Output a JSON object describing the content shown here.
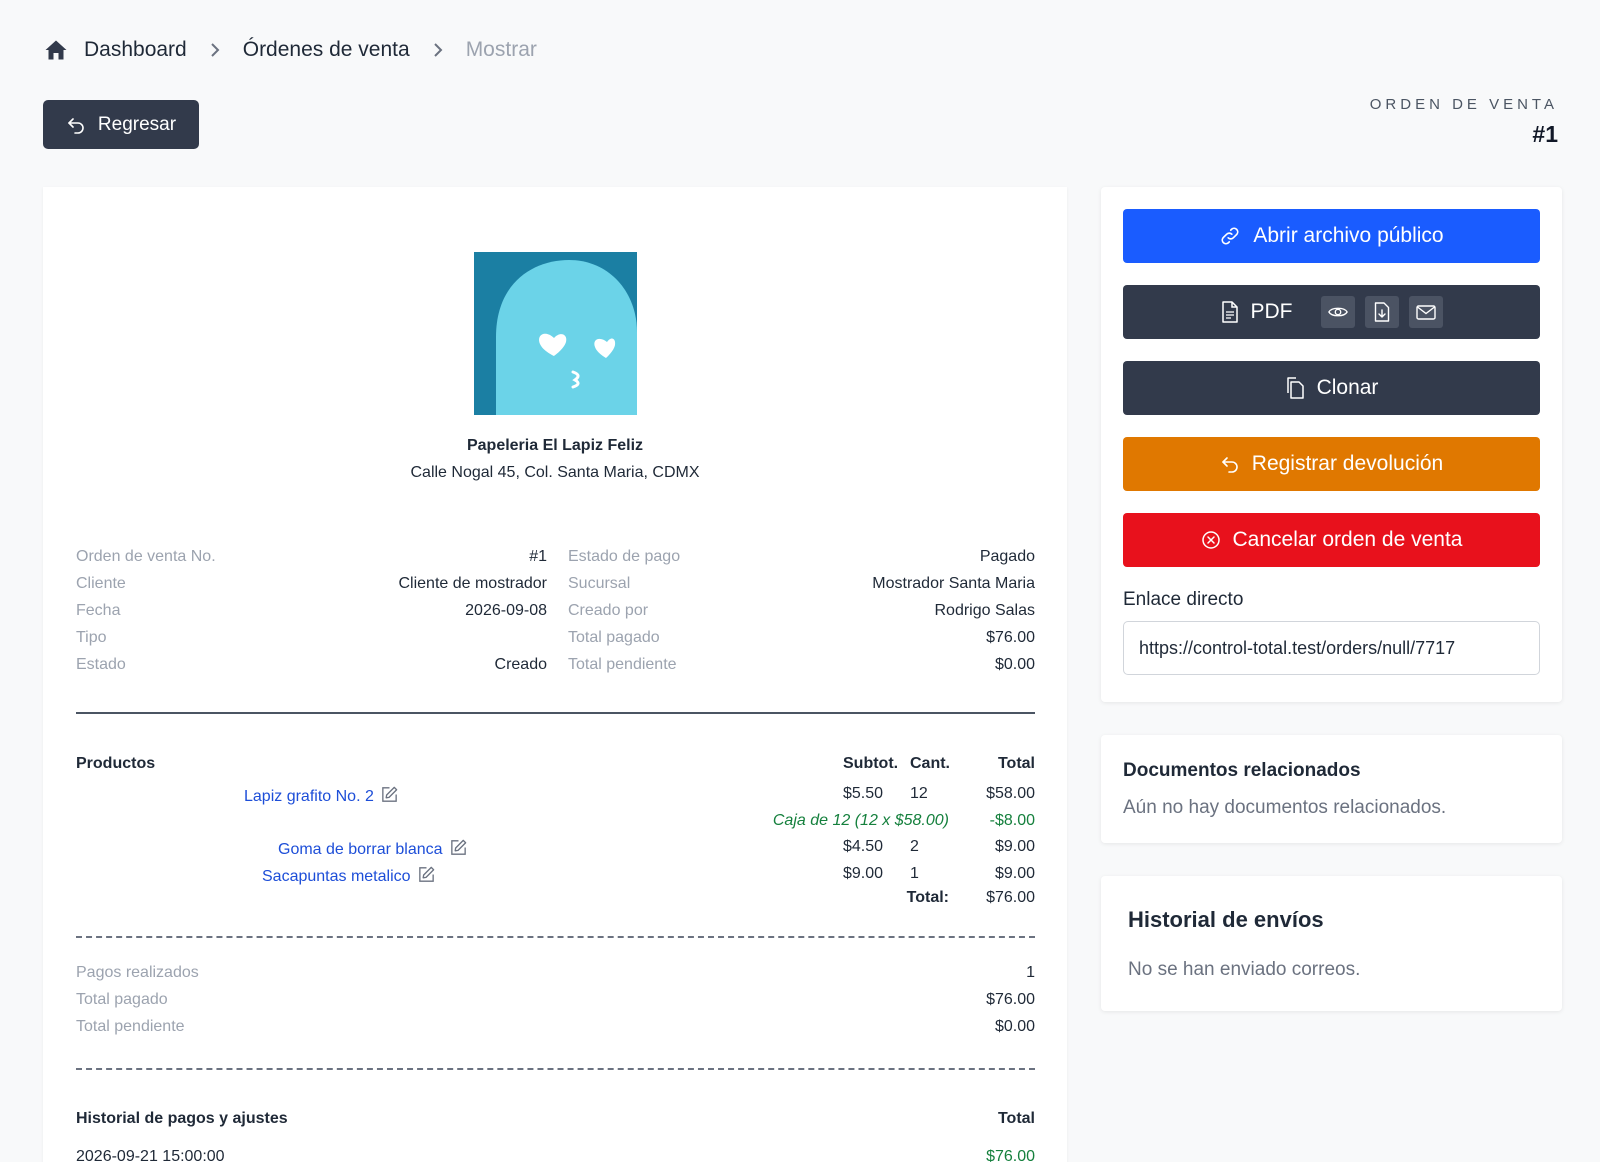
{
  "breadcrumb": {
    "items": [
      "Dashboard",
      "Órdenes de venta",
      "Mostrar"
    ]
  },
  "back_button": {
    "label": "Regresar"
  },
  "order_header": {
    "label": "ORDEN DE VENTA",
    "number": "#1"
  },
  "company": {
    "name": "Papeleria El Lapiz Feliz",
    "address": "Calle Nogal 45, Col. Santa Maria, CDMX"
  },
  "info_left": [
    {
      "label": "Orden de venta No.",
      "value": "#1"
    },
    {
      "label": "Cliente",
      "value": "Cliente de mostrador"
    },
    {
      "label": "Fecha",
      "value": "2026-09-08"
    },
    {
      "label": "Tipo",
      "value": ""
    },
    {
      "label": "Estado",
      "value": "Creado"
    }
  ],
  "info_right": [
    {
      "label": "Estado de pago",
      "value": "Pagado"
    },
    {
      "label": "Sucursal",
      "value": "Mostrador Santa Maria"
    },
    {
      "label": "Creado por",
      "value": "Rodrigo Salas"
    },
    {
      "label": "Total pagado",
      "value": "$76.00"
    },
    {
      "label": "Total pendiente",
      "value": "$0.00"
    }
  ],
  "products": {
    "header": {
      "title": "Productos",
      "subtotal": "Subtot.",
      "qty": "Cant.",
      "total": "Total"
    },
    "rows": [
      {
        "name": "Lapiz grafito No. 2",
        "subtotal": "$5.50",
        "qty": "12",
        "total": "$58.00"
      },
      {
        "name": "Goma de borrar blanca",
        "subtotal": "$4.50",
        "qty": "2",
        "total": "$9.00"
      },
      {
        "name": "Sacapuntas metalico",
        "subtotal": "$9.00",
        "qty": "1",
        "total": "$9.00"
      }
    ],
    "discount": {
      "label": "Caja de 12 (12 x $58.00)",
      "value": "-$8.00"
    },
    "total_label": "Total:",
    "total_value": "$76.00"
  },
  "payments_summary": [
    {
      "label": "Pagos realizados",
      "value": "1"
    },
    {
      "label": "Total pagado",
      "value": "$76.00"
    },
    {
      "label": "Total pendiente",
      "value": "$0.00"
    }
  ],
  "payment_history": {
    "title": "Historial de pagos y ajustes",
    "total_header": "Total",
    "rows": [
      {
        "date": "2026-09-21 15:00:00",
        "amount": "$76.00"
      }
    ]
  },
  "actions": {
    "open_public": "Abrir archivo público",
    "pdf": "PDF",
    "clone": "Clonar",
    "register_return": "Registrar devolución",
    "cancel_order": "Cancelar orden de venta",
    "direct_link_label": "Enlace directo",
    "direct_link_value": "https://control-total.test/orders/null/7717"
  },
  "related_docs": {
    "title": "Documentos relacionados",
    "empty": "Aún no hay documentos relacionados."
  },
  "shipping_history": {
    "title": "Historial de envíos",
    "empty": "No se han enviado correos."
  },
  "colors": {
    "primary": "#1a5cff",
    "dark": "#323a4b",
    "warning": "#e07800",
    "danger": "#e8111c",
    "link": "#1d4ed8",
    "success": "#15803d"
  }
}
